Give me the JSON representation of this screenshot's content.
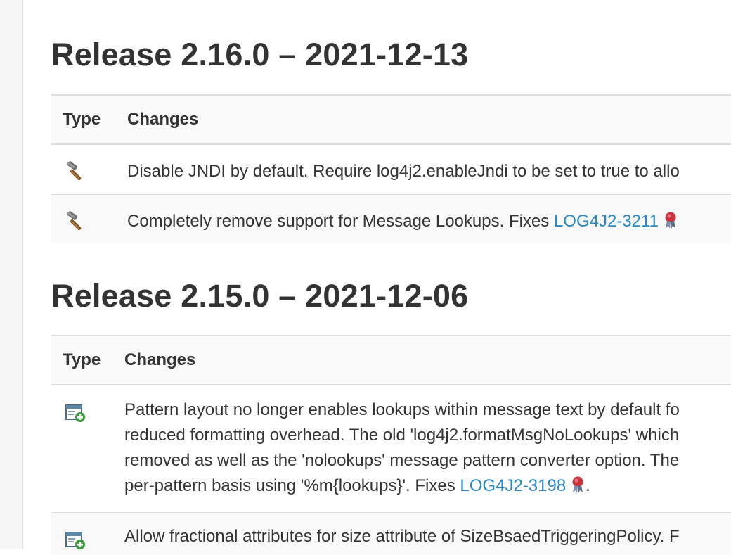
{
  "releases": [
    {
      "title": "Release 2.16.0 – 2021-12-13",
      "header": {
        "type": "Type",
        "changes": "Changes"
      },
      "rows": [
        {
          "type_icon": "hammer-fix-icon",
          "text": "Disable JNDI by default. Require log4j2.enableJndi to be set to true to allo"
        },
        {
          "type_icon": "hammer-fix-icon",
          "text_prefix": "Completely remove support for Message Lookups. Fixes ",
          "link": "LOG4J2-3211",
          "trailing_icon": "jira-badge-icon"
        }
      ]
    },
    {
      "title": "Release 2.15.0 – 2021-12-06",
      "header": {
        "type": "Type",
        "changes": "Changes"
      },
      "rows": [
        {
          "type_icon": "add-feature-icon",
          "lines": [
            "Pattern layout no longer enables lookups within message text by default fo",
            "reduced formatting overhead. The old 'log4j2.formatMsgNoLookups' which",
            "removed as well as the 'nolookups' message pattern converter option. The"
          ],
          "last_line_prefix": "per-pattern basis using '%m{lookups}'. Fixes ",
          "link": "LOG4J2-3198",
          "trailing_icon": "jira-badge-icon",
          "last_line_suffix": "."
        },
        {
          "type_icon": "add-feature-icon",
          "text": "Allow fractional attributes for size attribute of SizeBsaedTriggeringPolicy. F"
        }
      ]
    }
  ],
  "colors": {
    "link": "#2a89c4",
    "text": "#333333",
    "row_alt": "#f9f9f9",
    "border": "#dddddd"
  }
}
